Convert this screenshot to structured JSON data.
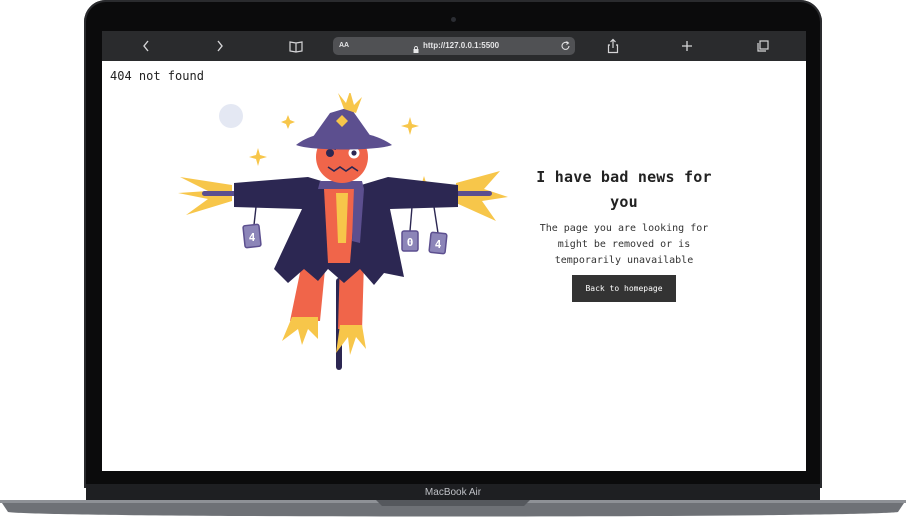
{
  "browser": {
    "text_size_label": "AA",
    "url": "http://127.0.0.1:5500",
    "icons": {
      "back": "chevron-left-icon",
      "forward": "chevron-right-icon",
      "bookmarks": "book-icon",
      "lock": "lock-icon",
      "reload": "reload-icon",
      "share": "share-icon",
      "new_tab": "plus-icon",
      "tabs": "tabs-icon"
    }
  },
  "page": {
    "corner_text": "404 not found",
    "headline": "I have bad news for you",
    "subtext": "The page you are looking for might be removed or is temporarily unavailable",
    "button_label": "Back to homepage",
    "can_left_digit": "4",
    "can_middle_digit": "0",
    "can_right_digit": "4"
  },
  "device": {
    "label": "MacBook Air"
  },
  "colors": {
    "button_bg": "#333333",
    "scarecrow_hat": "#5c4f8f",
    "scarecrow_body": "#f0654a",
    "coat": "#2c2752",
    "straw": "#f7c64a"
  }
}
